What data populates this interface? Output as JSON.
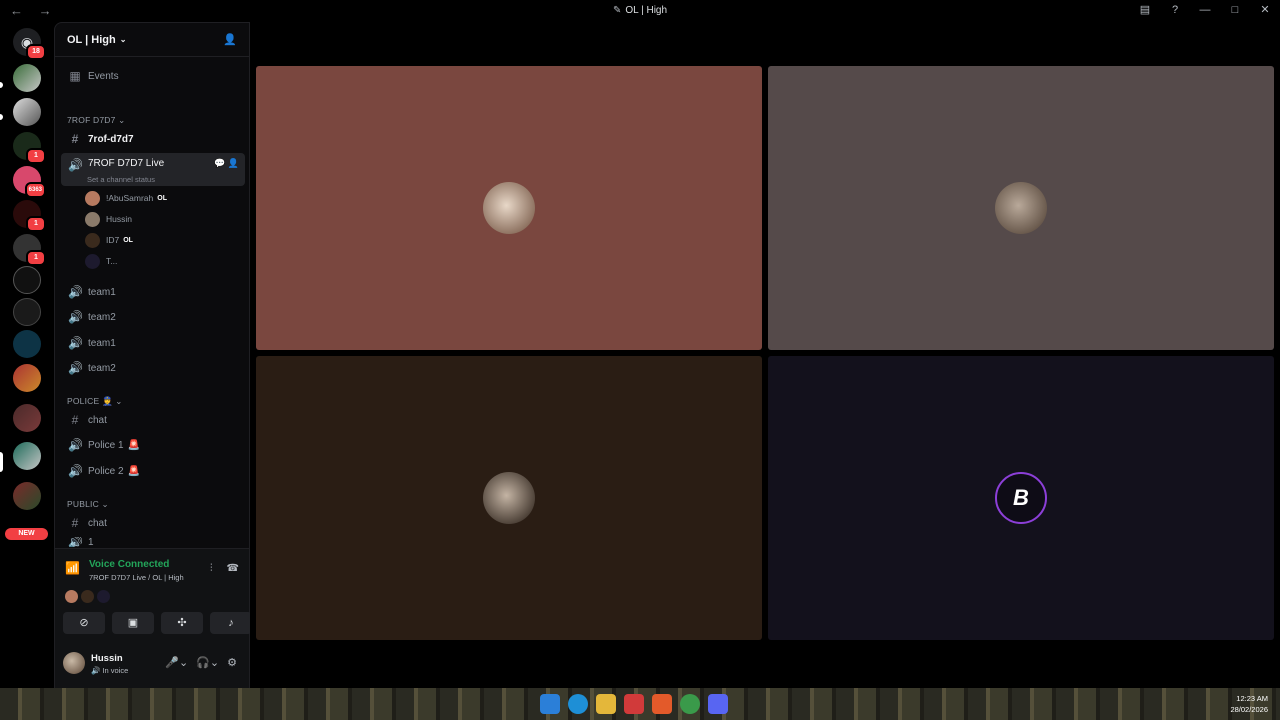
{
  "window": {
    "title": "OL | High",
    "nav": "← →"
  },
  "guilds": {
    "home_badge": "18",
    "badges": [
      "1",
      "6363",
      "1",
      "1"
    ],
    "new_label": "NEW"
  },
  "server": {
    "name": "OL | High"
  },
  "channels": {
    "events": "Events",
    "categories": {
      "trof": "7ROF D7D7",
      "police": "POLICE",
      "public": "PUBLIC"
    },
    "text_trof": "7rof-d7d7",
    "live": "7ROF D7D7 Live",
    "live_status": "Set a channel status",
    "members": [
      {
        "name": "!AbuSamrah",
        "tag": "OL"
      },
      {
        "name": "Hussin",
        "tag": ""
      },
      {
        "name": "ID7",
        "tag": "OL"
      },
      {
        "name": "T...",
        "tag": ""
      }
    ],
    "team_voice": [
      "team1",
      "team2",
      "team1",
      "team2"
    ],
    "police_chat": "chat",
    "police_voice": [
      "Police 1",
      "Police 2"
    ],
    "public_chat": "chat",
    "public_partial": "1"
  },
  "voice": {
    "title": "Voice Connected",
    "subtitle": "7ROF D7D7 Live / OL | High"
  },
  "user": {
    "name": "Hussin",
    "status": "In voice"
  },
  "stage": {
    "tile_colors": [
      "#7a473f",
      "#554a4a",
      "#2a1d14",
      "#13111c"
    ]
  },
  "taskbar": {
    "time": "12:23 AM",
    "date": "28/02/2026"
  },
  "icons": {
    "discord": "discord-icon",
    "add_member": "add-member-icon",
    "speaker": "speaker-icon",
    "hash": "hash-icon"
  },
  "colors": {
    "accent_green": "#23a55a",
    "badge_red": "#f23f43"
  }
}
